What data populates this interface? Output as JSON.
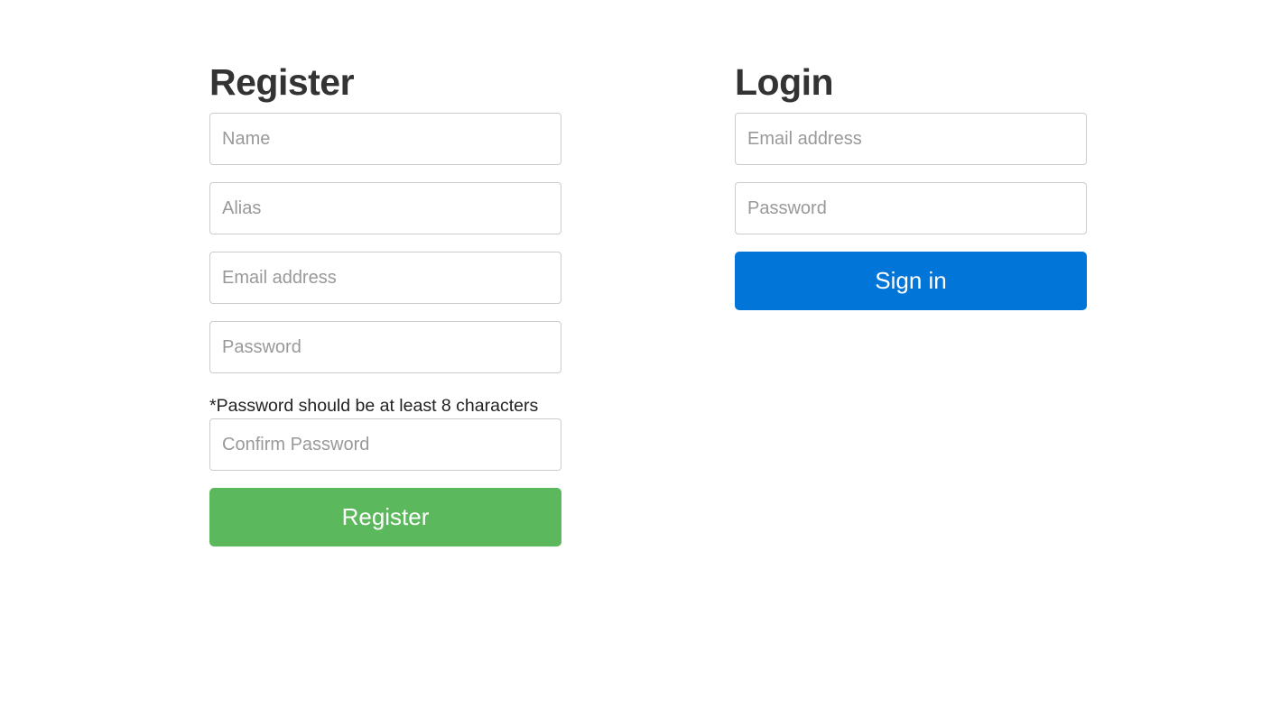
{
  "register": {
    "title": "Register",
    "name_placeholder": "Name",
    "alias_placeholder": "Alias",
    "email_placeholder": "Email address",
    "password_placeholder": "Password",
    "password_hint": "*Password should be at least 8 characters",
    "confirm_password_placeholder": "Confirm Password",
    "button_label": "Register",
    "button_color": "#5cb85c"
  },
  "login": {
    "title": "Login",
    "email_placeholder": "Email address",
    "password_placeholder": "Password",
    "button_label": "Sign in",
    "button_color": "#0275d8"
  }
}
